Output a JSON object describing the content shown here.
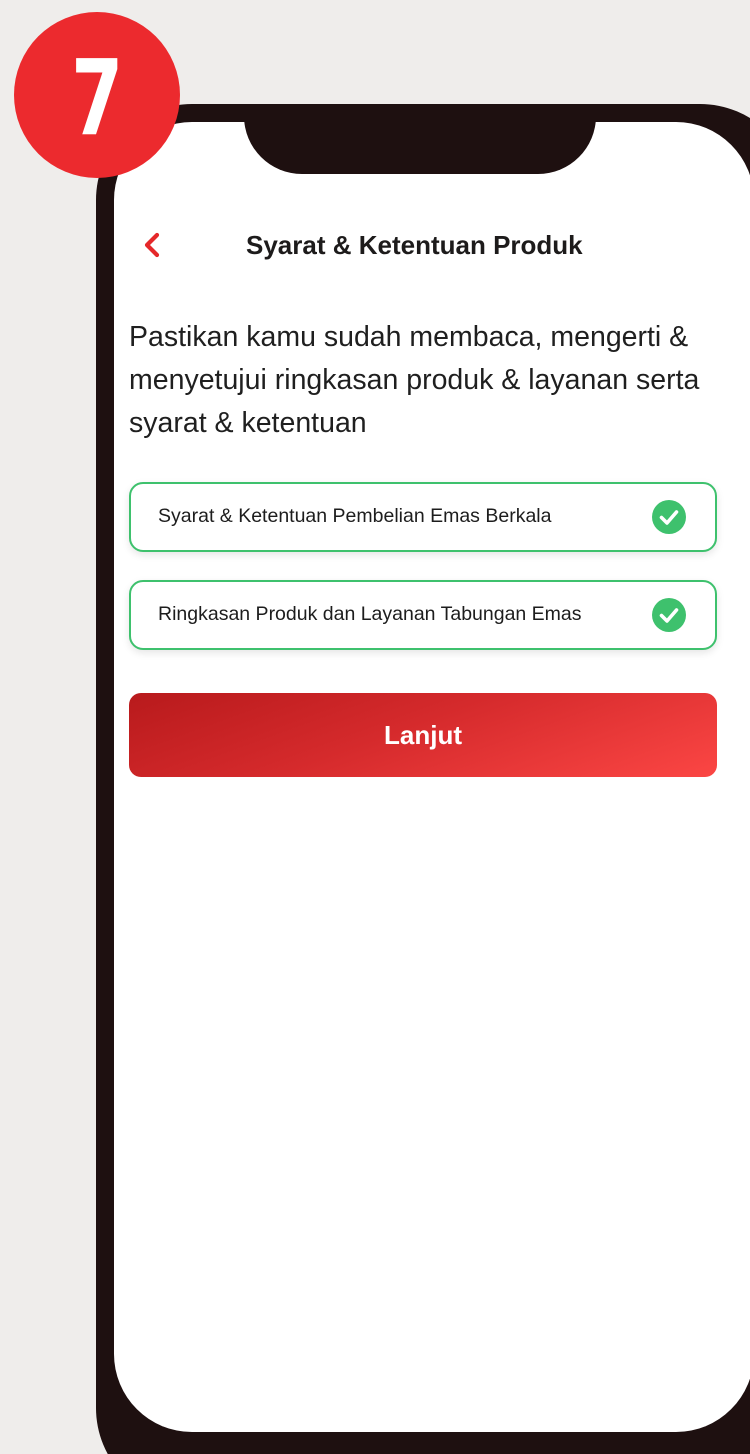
{
  "step": {
    "number": "7"
  },
  "header": {
    "title": "Syarat & Ketentuan Produk",
    "back_icon": "chevron-left-icon",
    "accent_color": "#e5282a"
  },
  "intro_text": "Pastikan kamu sudah membaca, mengerti & menyetujui ringkasan produk & layanan serta syarat & ketentuan",
  "documents": [
    {
      "label": "Syarat & Ketentuan Pembelian Emas Berkala",
      "status_icon": "check-circle-icon",
      "checked": true
    },
    {
      "label": "Ringkasan Produk dan Layanan Tabungan Emas",
      "status_icon": "check-circle-icon",
      "checked": true
    }
  ],
  "actions": {
    "continue_label": "Lanjut"
  },
  "colors": {
    "badge": "#ec2a2e",
    "check": "#3ec16d",
    "button_start": "#b81a1c",
    "button_end": "#fb4644"
  }
}
